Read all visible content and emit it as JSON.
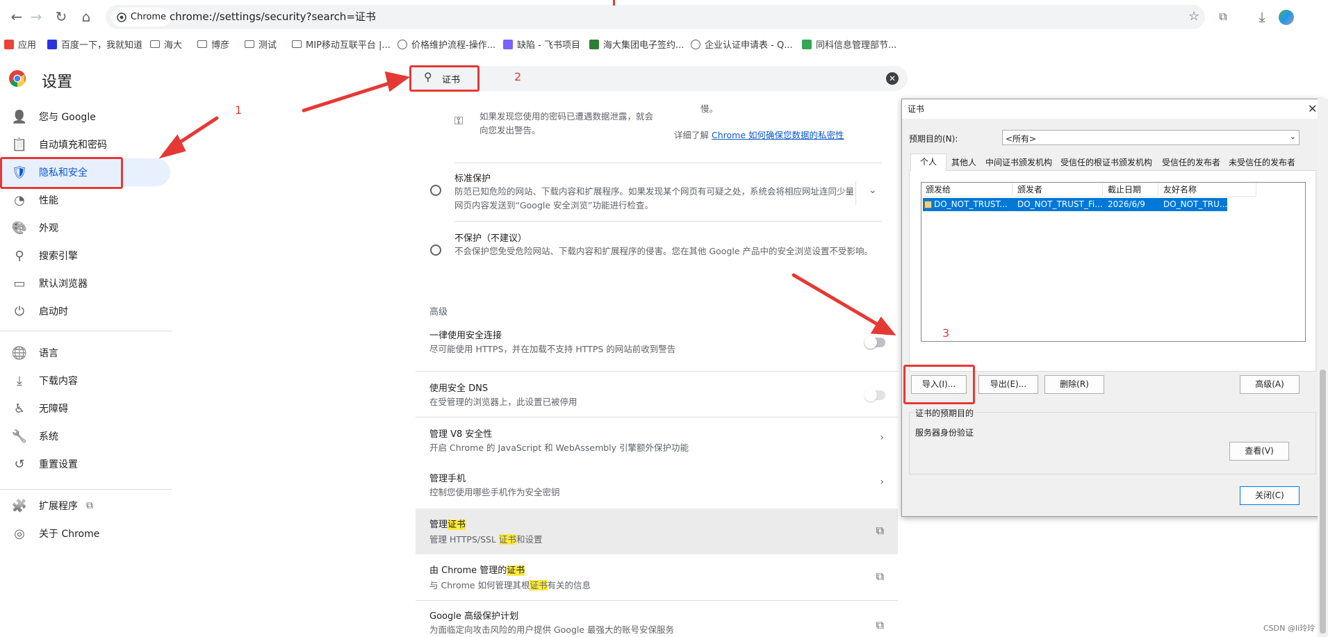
{
  "browser": {
    "chip_label": "Chrome",
    "url": "chrome://settings/security?search=证书",
    "bookmarks": [
      {
        "label": "应用",
        "icon": "apps-grid-icon"
      },
      {
        "label": "百度一下，我就知道",
        "icon": "baidu-paw-icon"
      },
      {
        "label": "海大",
        "icon": "folder-icon"
      },
      {
        "label": "博彦",
        "icon": "folder-icon"
      },
      {
        "label": "测试",
        "icon": "folder-icon"
      },
      {
        "label": "MIP移动互联平台 |...",
        "icon": "folder-icon"
      },
      {
        "label": "价格维护流程-操作...",
        "icon": "globe-icon"
      },
      {
        "label": "缺陷 - 飞书项目",
        "icon": "feishu-icon"
      },
      {
        "label": "海大集团电子签约...",
        "icon": "haida-icon"
      },
      {
        "label": "企业认证申请表 - Q...",
        "icon": "chrome-icon"
      },
      {
        "label": "同科信息管理部节...",
        "icon": "green-doc-icon"
      }
    ]
  },
  "settings": {
    "title": "设置",
    "search_value": "证书",
    "sidebar": [
      {
        "label": "您与 Google",
        "icon": "person-icon",
        "selected": false
      },
      {
        "label": "自动填充和密码",
        "icon": "clipboard-icon",
        "selected": false
      },
      {
        "label": "隐私和安全",
        "icon": "shield-icon",
        "selected": true
      },
      {
        "label": "性能",
        "icon": "speedometer-icon",
        "selected": false
      },
      {
        "label": "外观",
        "icon": "palette-icon",
        "selected": false
      },
      {
        "label": "搜索引擎",
        "icon": "search-icon",
        "selected": false
      },
      {
        "label": "默认浏览器",
        "icon": "browser-window-icon",
        "selected": false
      },
      {
        "label": "启动时",
        "icon": "power-icon",
        "selected": false
      },
      {
        "label": "语言",
        "icon": "globe-icon",
        "selected": false
      },
      {
        "label": "下载内容",
        "icon": "download-icon",
        "selected": false
      },
      {
        "label": "无障碍",
        "icon": "accessibility-icon",
        "selected": false
      },
      {
        "label": "系统",
        "icon": "wrench-icon",
        "selected": false
      },
      {
        "label": "重置设置",
        "icon": "history-icon",
        "selected": false
      },
      {
        "label": "扩展程序",
        "icon": "puzzle-icon",
        "selected": false
      },
      {
        "label": "关于 Chrome",
        "icon": "chrome-icon",
        "selected": false
      }
    ],
    "content": {
      "leak_text": "如果发现您使用的密码已遭遇数据泄露，就会向您发出警告。",
      "slow_text": "慢。",
      "learn_more_prefix": "详细了解",
      "learn_more_link": "Chrome 如何确保您数据的私密性",
      "standard_title": "标准保护",
      "standard_desc": "防范已知危险的网站、下载内容和扩展程序。如果发现某个网页有可疑之处，系统会将相应网址连同少量网页内容发送到“Google 安全浏览”功能进行检查。",
      "noprotect_title": "不保护（不建议）",
      "noprotect_desc": "不会保护您免受危险网站、下载内容和扩展程序的侵害。您在其他 Google 产品中的安全浏览设置不受影响。",
      "advanced_heading": "高级",
      "https_title": "一律使用安全连接",
      "https_desc": "尽可能使用 HTTPS，并在加载不支持 HTTPS 的网站前收到警告",
      "dns_title": "使用安全 DNS",
      "dns_desc": "在受管理的浏览器上，此设置已被停用",
      "v8_title": "管理 V8 安全性",
      "v8_desc": "开启 Chrome 的 JavaScript 和 WebAssembly 引擎额外保护功能",
      "phone_title": "管理手机",
      "phone_desc": "控制您使用哪些手机作为安全密钥",
      "cert_title_prefix": "管理",
      "cert_title_hl": "证书",
      "cert_desc_prefix": "管理 HTTPS/SSL ",
      "cert_desc_hl": "证书",
      "cert_desc_suffix": "和设置",
      "chromecert_title_prefix": "由 Chrome 管理的",
      "chromecert_title_hl": "证书",
      "chromecert_desc_prefix": "与 Chrome 如何管理其根",
      "chromecert_desc_hl": "证书",
      "chromecert_desc_suffix": "有关的信息",
      "gapp_title": "Google 高级保护计划",
      "gapp_desc": "为面临定向攻击风险的用户提供 Google 最强大的账号安保服务"
    }
  },
  "dialog": {
    "title": "证书",
    "purpose_label": "预期目的(N):",
    "purpose_value": "<所有>",
    "tabs": [
      "个人",
      "其他人",
      "中间证书颁发机构",
      "受信任的根证书颁发机构",
      "受信任的发布者",
      "未受信任的发布者"
    ],
    "columns": [
      "颁发给",
      "颁发者",
      "截止日期",
      "友好名称"
    ],
    "rows": [
      {
        "issued_to": "DO_NOT_TRUST...",
        "issuer": "DO_NOT_TRUST_Fi...",
        "expires": "2026/6/9",
        "friendly": "DO_NOT_TRU..."
      }
    ],
    "import_label": "导入(I)...",
    "export_label": "导出(E)...",
    "remove_label": "删除(R)",
    "advanced_label": "高级(A)",
    "purposes_group": "证书的预期目的",
    "purposes_value": "服务器身份验证",
    "view_label": "查看(V)",
    "close_label": "关闭(C)"
  },
  "annotations": {
    "step1": "1",
    "step2": "2",
    "step3": "3",
    "color": "#e53935"
  },
  "watermark": "CSDN @Ii玲玲"
}
